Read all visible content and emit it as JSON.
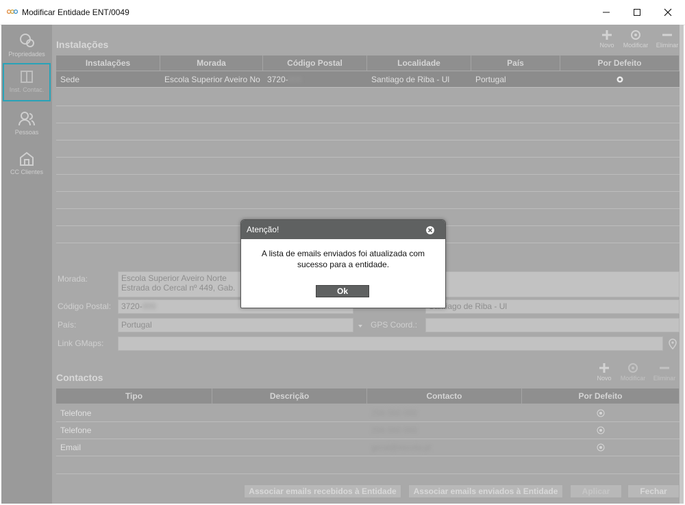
{
  "window": {
    "title": "Modificar Entidade ENT/0049"
  },
  "sidebar": {
    "items": [
      {
        "label": "Propriedades"
      },
      {
        "label": "Inst. Contac."
      },
      {
        "label": "Pessoas"
      },
      {
        "label": "CC Clientes"
      }
    ]
  },
  "instalacoes": {
    "title": "Instalações",
    "toolbar": {
      "new": "Novo",
      "edit": "Modificar",
      "delete": "Eliminar"
    },
    "columns": [
      "Instalações",
      "Morada",
      "Código Postal",
      "Localidade",
      "País",
      "Por Defeito"
    ],
    "rows": [
      {
        "instalacao": "Sede",
        "morada": "Escola Superior Aveiro No",
        "codigo_postal": "3720-",
        "codigo_postal_hidden": "000",
        "localidade": "Santiago de Riba - Ul",
        "pais": "Portugal"
      }
    ]
  },
  "detail": {
    "morada_label": "Morada:",
    "morada_line1": "Escola Superior Aveiro Norte",
    "morada_line2": "Estrada do Cercal nº 449, Gab. ",
    "codigo_postal_label": "Código Postal:",
    "codigo_postal_value": "3720-",
    "codigo_postal_hidden": "000",
    "localidade_value": "Santiago de Riba - Ul",
    "pais_label": "País:",
    "pais_value": "Portugal",
    "gps_label": "GPS Coord.:",
    "gmaps_label": "Link GMaps:"
  },
  "contactos": {
    "title": "Contactos",
    "toolbar": {
      "new": "Novo",
      "edit": "Modificar",
      "delete": "Eliminar"
    },
    "columns": [
      "Tipo",
      "Descrição",
      "Contacto",
      "Por Defeito"
    ],
    "rows": [
      {
        "tipo": "Telefone",
        "contacto": "256 000 000"
      },
      {
        "tipo": "Telefone",
        "contacto": "256 000 000"
      },
      {
        "tipo": "Email",
        "contacto": "geral@escola.pt"
      }
    ]
  },
  "footer": {
    "btn_recebidos": "Associar emails recebidos à Entidade",
    "btn_enviados": "Associar emails enviados à Entidade",
    "btn_aplicar": "Aplicar",
    "btn_fechar": "Fechar"
  },
  "dialog": {
    "title": "Atenção!",
    "message": "A lista de emails enviados foi atualizada com sucesso para a entidade.",
    "ok": "Ok"
  }
}
